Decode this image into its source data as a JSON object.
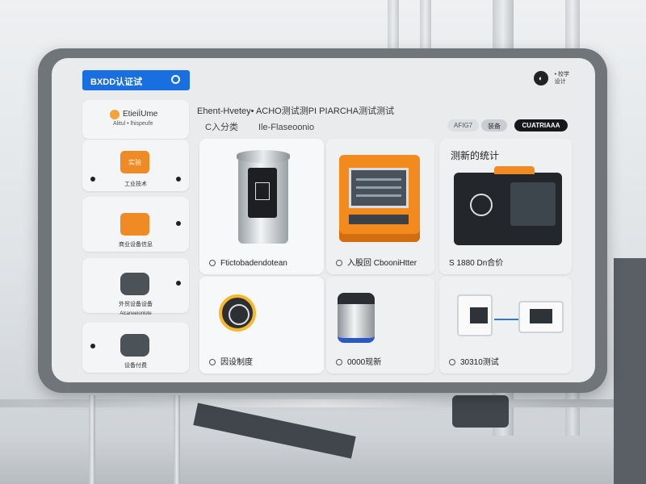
{
  "header": {
    "search_label": "BXDD认证试",
    "right_text": "• 校学\n设计"
  },
  "sidebar": {
    "top_title": "EtieiİUme",
    "top_sub": "Alitul • lhispeufe",
    "items": [
      {
        "icon_text": "实验",
        "label": "工业技术"
      },
      {
        "icon_text": "",
        "label": "商业设备信息"
      },
      {
        "icon_text": "",
        "label": "外贸设备设备"
      },
      {
        "icon_text": "",
        "label": "设备付费"
      }
    ],
    "extra_label": "Alcaneeionlote"
  },
  "main": {
    "breadcrumb": "Ehent-Hvetey• ACHO测试测PI PIARCHA测试测试",
    "sub_left": "C入分类",
    "sub_right": "Ile-Flaseoonio",
    "chips": [
      "AFIG7",
      "装备",
      "CUATRIAAA"
    ],
    "cards": [
      {
        "caption": "Ftictobadendotean"
      },
      {
        "caption": "入股回 CbooniHtter"
      },
      {
        "header": "测新的统计",
        "caption": "S 1880   Dn合价"
      },
      {
        "caption": "因设制度"
      },
      {
        "caption": "0000现新"
      },
      {
        "caption": "30310测试"
      }
    ]
  },
  "colors": {
    "accent": "#1a6fe0",
    "orange": "#f08a24",
    "dark_chip": "#15171a"
  }
}
